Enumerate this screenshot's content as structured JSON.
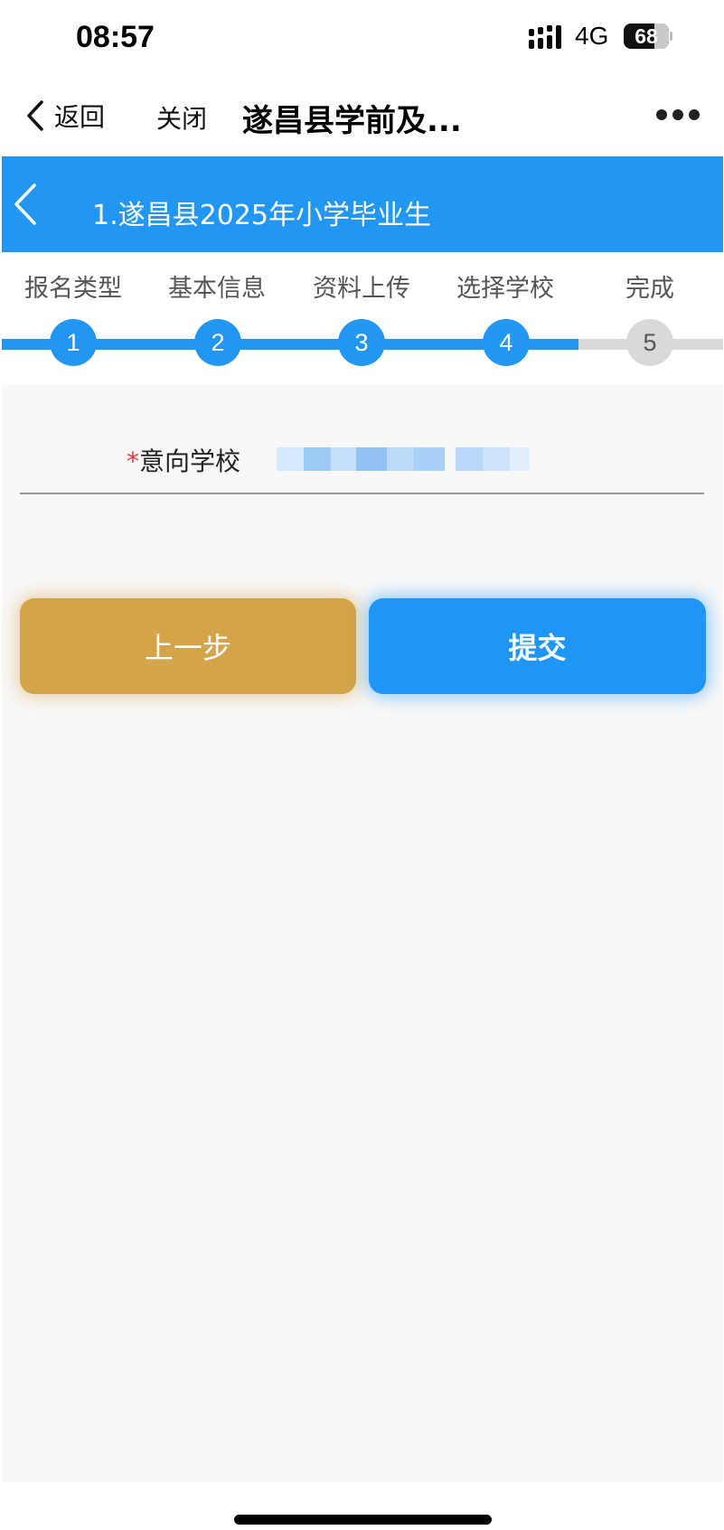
{
  "status_bar": {
    "time": "08:57",
    "network": "4G",
    "battery": "68"
  },
  "nav": {
    "back_label": "返回",
    "close_label": "关闭",
    "title": "遂昌县学前及...",
    "more_icon": "more-dots-icon"
  },
  "header": {
    "title": "1.遂昌县2025年小学毕业生"
  },
  "steps": {
    "current": 4,
    "items": [
      {
        "label": "报名类型",
        "number": "1"
      },
      {
        "label": "基本信息",
        "number": "2"
      },
      {
        "label": "资料上传",
        "number": "3"
      },
      {
        "label": "选择学校",
        "number": "4"
      },
      {
        "label": "完成",
        "number": "5"
      }
    ]
  },
  "form": {
    "school_label": "意向学校",
    "required_mark": "*"
  },
  "buttons": {
    "prev_label": "上一步",
    "submit_label": "提交"
  },
  "colors": {
    "primary": "#2196f3",
    "prev_button": "#d4a44a",
    "required": "#e53935"
  }
}
